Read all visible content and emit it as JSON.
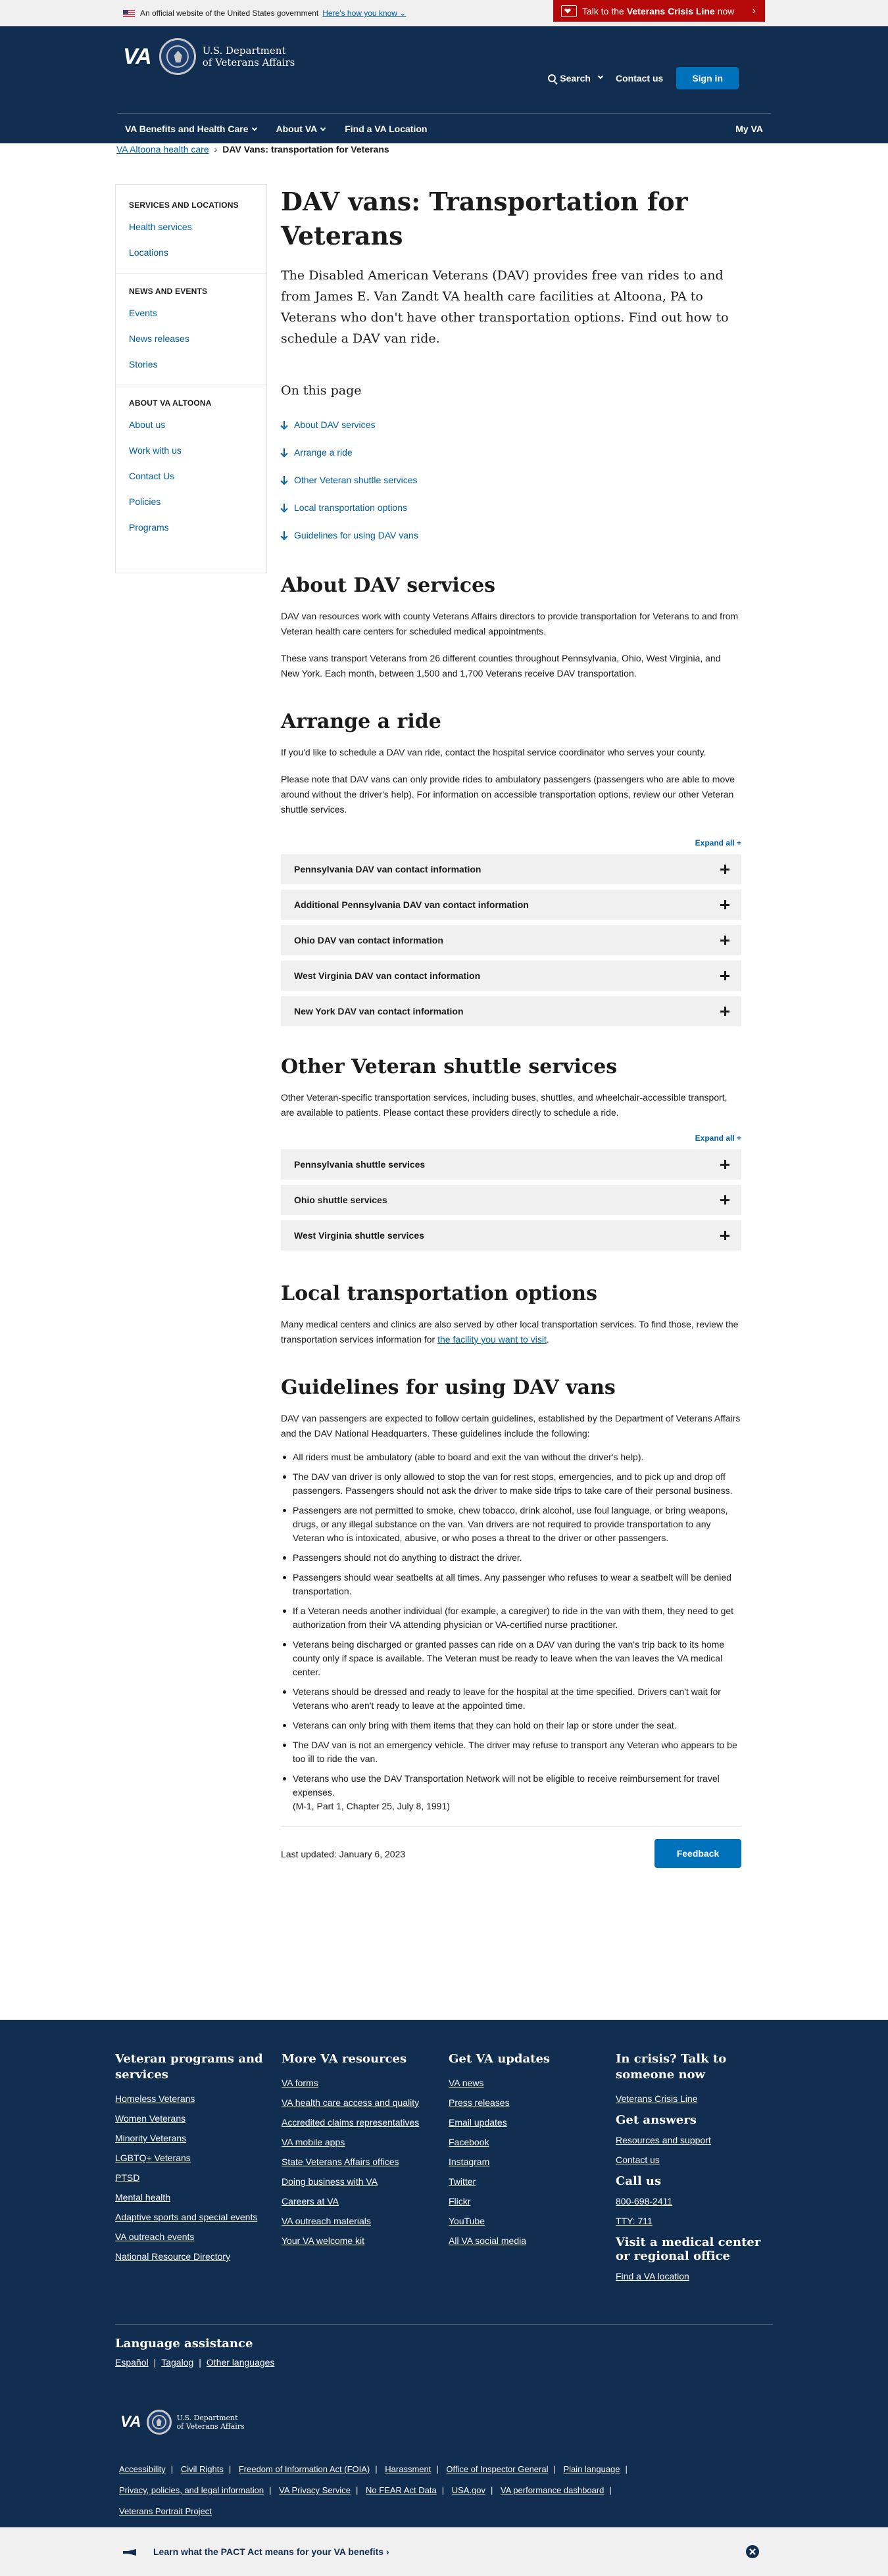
{
  "banner": {
    "official_text": "An official website of the United States government",
    "how_link": "Here's how you know",
    "crisis_prefix": "Talk to the",
    "crisis_bold": "Veterans Crisis Line",
    "crisis_suffix": "now"
  },
  "header": {
    "logo_text": "VA",
    "dept_line1": "U.S. Department",
    "dept_line2": "of Veterans Affairs",
    "search": "Search",
    "contact": "Contact us",
    "signin": "Sign in"
  },
  "nav": {
    "items": [
      "VA Benefits and Health Care",
      "About VA",
      "Find a VA Location"
    ],
    "myva": "My VA"
  },
  "breadcrumb": {
    "parent": "VA Altoona health care",
    "current": "DAV Vans: transportation for Veterans"
  },
  "sidebar": {
    "sections": [
      {
        "title": "SERVICES AND LOCATIONS",
        "links": [
          "Health services",
          "Locations"
        ]
      },
      {
        "title": "NEWS AND EVENTS",
        "links": [
          "Events",
          "News releases",
          "Stories"
        ]
      },
      {
        "title": "ABOUT VA ALTOONA",
        "links": [
          "About us",
          "Work with us",
          "Contact Us",
          "Policies",
          "Programs"
        ]
      }
    ]
  },
  "main": {
    "title": "DAV vans: Transportation for Veterans",
    "lead": "The Disabled American Veterans (DAV) provides free van rides to and from James E. Van Zandt VA health care facilities at Altoona, PA to Veterans who don't have other transportation options. Find out how to schedule a DAV van ride.",
    "on_this_page": "On this page",
    "otp_links": [
      "About DAV services",
      "Arrange a ride",
      "Other Veteran shuttle services",
      "Local transportation options",
      "Guidelines for using DAV vans"
    ],
    "about": {
      "heading": "About DAV services",
      "p1": "DAV van resources work with county Veterans Affairs directors to provide transportation for Veterans to and from Veteran health care centers for scheduled medical appointments.",
      "p2": "These vans transport Veterans from 26 different counties throughout Pennsylvania, Ohio, West Virginia, and New York. Each month, between 1,500 and 1,700 Veterans receive DAV transportation."
    },
    "arrange": {
      "heading": "Arrange a ride",
      "p1": "If you'd like to schedule a DAV van ride, contact the hospital service coordinator who serves your county.",
      "p2": "Please note that DAV vans can only provide rides to ambulatory passengers (passengers who are able to move around without the driver's help). For information on accessible transportation options, review our other Veteran shuttle services.",
      "expand": "Expand all +",
      "accordions": [
        "Pennsylvania DAV van contact information",
        "Additional Pennsylvania DAV van contact information",
        "Ohio DAV van contact information",
        "West Virginia DAV van contact information",
        "New York DAV van contact information"
      ]
    },
    "shuttle": {
      "heading": "Other Veteran shuttle services",
      "p1": "Other Veteran-specific transportation services, including buses, shuttles, and wheelchair-accessible transport, are available to patients. Please contact these providers directly to schedule a ride.",
      "expand": "Expand all +",
      "accordions": [
        "Pennsylvania shuttle services",
        "Ohio shuttle services",
        "West Virginia shuttle services"
      ]
    },
    "local": {
      "heading": "Local transportation options",
      "p1_before": "Many medical centers and clinics are also served by other local transportation services. To find those, review the transportation services information for ",
      "p1_link": "the facility you want to visit",
      "p1_after": "."
    },
    "guidelines": {
      "heading": "Guidelines for using DAV vans",
      "intro": "DAV van passengers are expected to follow certain guidelines, established by the Department of Veterans Affairs and the DAV National Headquarters. These guidelines include the following:",
      "items": [
        "All riders must be ambulatory (able to board and exit the van without the driver's help).",
        "The DAV van driver is only allowed to stop the van for rest stops, emergencies, and to pick up and drop off passengers. Passengers should not ask the driver to make side trips to take care of their personal business.",
        "Passengers are not permitted to smoke, chew tobacco, drink alcohol, use foul language, or bring weapons, drugs, or any illegal substance on the van. Van drivers are not required to provide transportation to any Veteran who is intoxicated, abusive, or who poses a threat to the driver or other passengers.",
        "Passengers should not do anything to distract the driver.",
        "Passengers should wear seatbelts at all times. Any passenger who refuses to wear a seatbelt will be denied transportation.",
        "If a Veteran needs another individual (for example, a caregiver) to ride in the van with them, they need to get authorization from their VA attending physician or VA-certified nurse practitioner.",
        "Veterans being discharged or granted passes can ride on a DAV van during the van's trip back to its home county only if space is available. The Veteran must be ready to leave when the van leaves the VA medical center.",
        "Veterans should be dressed and ready to leave for the hospital at the time specified. Drivers can't wait for Veterans who aren't ready to leave at the appointed time.",
        "Veterans can only bring with them items that they can hold on their lap or store under the seat.",
        "The DAV van is not an emergency vehicle. The driver may refuse to transport any Veteran who appears to be too ill to ride the van.",
        "Veterans who use the DAV Transportation Network will not be eligible to receive reimbursement for travel expenses."
      ],
      "citation": "(M-1, Part 1, Chapter 25, July 8, 1991)"
    },
    "last_updated": "Last updated: January 6, 2023",
    "feedback": "Feedback"
  },
  "footer": {
    "col1": {
      "title": "Veteran programs and services",
      "links": [
        "Homeless Veterans",
        "Women Veterans",
        "Minority Veterans",
        "LGBTQ+ Veterans",
        "PTSD",
        "Mental health",
        "Adaptive sports and special events",
        "VA outreach events",
        "National Resource Directory"
      ]
    },
    "col2": {
      "title": "More VA resources",
      "links": [
        "VA forms",
        "VA health care access and quality",
        "Accredited claims representatives",
        "VA mobile apps",
        "State Veterans Affairs offices",
        "Doing business with VA",
        "Careers at VA",
        "VA outreach materials",
        "Your VA welcome kit"
      ]
    },
    "col3": {
      "title": "Get VA updates",
      "links": [
        "VA news",
        "Press releases",
        "Email updates",
        "Facebook",
        "Instagram",
        "Twitter",
        "Flickr",
        "YouTube",
        "All VA social media"
      ]
    },
    "col4": {
      "title": "In crisis? Talk to someone now",
      "crisis_link": "Veterans Crisis Line",
      "answers_title": "Get answers",
      "answers_links": [
        "Resources and support",
        "Contact us"
      ],
      "call_title": "Call us",
      "phones": [
        "800-698-2411",
        "TTY: 711"
      ],
      "visit_title": "Visit a medical center or regional office",
      "visit_link": "Find a VA location"
    },
    "language": {
      "title": "Language assistance",
      "links": [
        "Español",
        "Tagalog",
        "Other languages"
      ]
    },
    "legal_links": [
      "Accessibility",
      "Civil Rights",
      "Freedom of Information Act (FOIA)",
      "Harassment",
      "Office of Inspector General",
      "Plain language",
      "Privacy, policies, and legal information",
      "VA Privacy Service",
      "No FEAR Act Data",
      "USA.gov",
      "VA performance dashboard",
      "Veterans Portrait Project"
    ]
  },
  "pact": {
    "text": "Learn what the PACT Act means for your VA benefits ›"
  }
}
